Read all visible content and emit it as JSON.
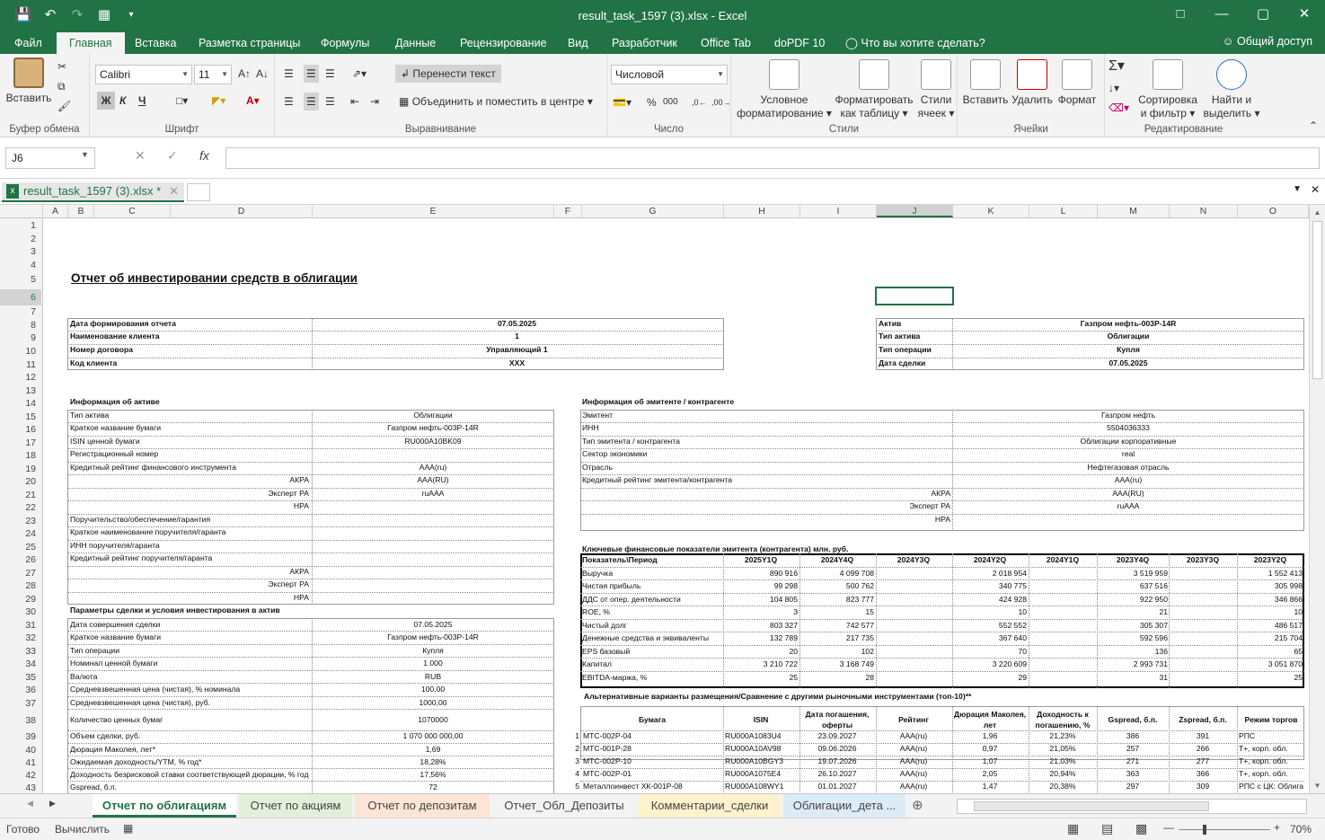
{
  "window": {
    "title": "result_task_1597 (3).xlsx - Excel",
    "share": "Общий доступ"
  },
  "tabs": [
    "Файл",
    "Главная",
    "Вставка",
    "Разметка страницы",
    "Формулы",
    "Данные",
    "Рецензирование",
    "Вид",
    "Разработчик",
    "Office Tab",
    "doPDF 10",
    "Что вы хотите сделать?"
  ],
  "ribbon": {
    "clipboard": {
      "label": "Буфер обмена",
      "paste": "Вставить"
    },
    "font": {
      "label": "Шрифт",
      "name": "Calibri",
      "size": "11",
      "bold": "Ж",
      "italic": "К",
      "underline": "Ч"
    },
    "align": {
      "label": "Выравнивание",
      "wrap": "Перенести текст",
      "merge": "Объединить и поместить в центре"
    },
    "number": {
      "label": "Число",
      "format": "Числовой",
      "pct": "%",
      "thousands": "000"
    },
    "styles": {
      "label": "Стили",
      "cond": "Условное",
      "cond2": "форматирование",
      "fmt": "Форматировать",
      "fmt2": "как таблицу",
      "cell": "Стили",
      "cell2": "ячеек"
    },
    "cells": {
      "label": "Ячейки",
      "insert": "Вставить",
      "delete": "Удалить",
      "format": "Формат"
    },
    "edit": {
      "label": "Редактирование",
      "sort": "Сортировка",
      "sort2": "и фильтр",
      "find": "Найти и",
      "find2": "выделить"
    }
  },
  "formula": {
    "namebox": "J6",
    "fx": "fx",
    "value": ""
  },
  "workbook_tab": "result_task_1597 (3).xlsx *",
  "columns": [
    "A",
    "B",
    "C",
    "D",
    "E",
    "F",
    "G",
    "H",
    "I",
    "J",
    "K",
    "L",
    "M",
    "N",
    "O"
  ],
  "rows": [
    "1",
    "2",
    "3",
    "4",
    "5",
    "6",
    "7",
    "8",
    "9",
    "10",
    "11",
    "12",
    "13",
    "14",
    "15",
    "16",
    "17",
    "18",
    "19",
    "20",
    "21",
    "22",
    "23",
    "24",
    "25",
    "26",
    "27",
    "28",
    "29",
    "30",
    "31",
    "32",
    "33",
    "34",
    "35",
    "36",
    "37",
    "38",
    "39",
    "40",
    "41",
    "42",
    "43"
  ],
  "report": {
    "title": "Отчет об инвестировании средств в облигации",
    "header": [
      [
        "Дата формирования отчета",
        "07.05.2025"
      ],
      [
        "Наименование клиента",
        "1"
      ],
      [
        "Номер договора",
        "Управляющий 1"
      ],
      [
        "Код клиента",
        "XXX"
      ]
    ],
    "asset": [
      [
        "Актив",
        "Газпром нефть-003P-14R"
      ],
      [
        "Тип актива",
        "Облигации"
      ],
      [
        "Тип операции",
        "Купля"
      ],
      [
        "Дата сделки",
        "07.05.2025"
      ]
    ],
    "info_title": "Информация об активе",
    "info": [
      [
        "Тип актива",
        "Облигации"
      ],
      [
        "Краткое название бумаги",
        "Газпром нефть-003P-14R"
      ],
      [
        "ISIN ценной бумаги",
        "RU000A10BK09"
      ],
      [
        "Регистрационный номер",
        ""
      ],
      [
        "Кредитный рейтинг финансового инструмента",
        "AAA(ru)"
      ],
      [
        "АКРА",
        "AAA(RU)"
      ],
      [
        "Эксперт РА",
        "ruAAA"
      ],
      [
        "НРА",
        ""
      ],
      [
        "Поручительство/обеспечение/гарантия",
        ""
      ],
      [
        "Краткое наименование поручителя/гаранта",
        ""
      ],
      [
        "ИНН поручителя/гаранта",
        ""
      ],
      [
        "Кредитный рейтинг поручителя/гаранта",
        ""
      ],
      [
        "АКРА",
        ""
      ],
      [
        "Эксперт РА",
        ""
      ],
      [
        "НРА",
        ""
      ]
    ],
    "params_title": "Параметры сделки и условия инвестирования в актив",
    "params": [
      [
        "Дата совершения сделки",
        "07.05.2025"
      ],
      [
        "Краткое название бумаги",
        "Газпром нефть-003P-14R"
      ],
      [
        "Тип операции",
        "Купля"
      ],
      [
        "Номинал ценной бумаги",
        "1 000"
      ],
      [
        "Валюта",
        "RUB"
      ],
      [
        "Средневзвешенная цена (чистая), % номинала",
        "100,00"
      ],
      [
        "Средневзвешенная цена (чистая), руб.",
        "1000,00"
      ],
      [
        "Количество ценных бумаг",
        "1070000"
      ],
      [
        "Объем сделки, руб.",
        "1 070 000 000,00"
      ],
      [
        "Дюрация Маколея, лет*",
        "1,69"
      ],
      [
        "Ожидаемая доходность/YTM, % год*",
        "18,28%"
      ],
      [
        "Доходность безрисковой ставки соответствующей дюрации, % год",
        "17,56%"
      ],
      [
        "Gspread, б.п.",
        "72"
      ]
    ],
    "issuer_title": "Информация об эмитенте / контрагенте",
    "issuer": [
      [
        "Эмитент",
        "Газпром нефть"
      ],
      [
        "ИНН",
        "5504036333"
      ],
      [
        "Тип эмитента / контрагента",
        "Облигации корпоративные"
      ],
      [
        "Сектор экономики",
        "real"
      ],
      [
        "Отрасль",
        "Нефтегазовая отрасль"
      ],
      [
        "Кредитный рейтинг эмитента/контрагента",
        "AAA(ru)"
      ],
      [
        "АКРА",
        "AAA(RU)"
      ],
      [
        "Эксперт РА",
        "ruAAA"
      ],
      [
        "НРА",
        ""
      ]
    ],
    "fin_title": "Ключевые финансовые показатели эмитента (контрагента) млн. руб.",
    "fin_head": [
      "Показатель\\Период",
      "2025Y1Q",
      "2024Y4Q",
      "2024Y3Q",
      "2024Y2Q",
      "2024Y1Q",
      "2023Y4Q",
      "2023Y3Q",
      "2023Y2Q"
    ],
    "fin": [
      [
        "Выручка",
        "890 916",
        "4 099 708",
        "",
        "2 018 954",
        "",
        "3 519 959",
        "",
        "1 552 413"
      ],
      [
        "Чистая прибыль",
        "99 298",
        "500 762",
        "",
        "340 775",
        "",
        "637 516",
        "",
        "305 998"
      ],
      [
        "ДДС от опер. деятельности",
        "104 805",
        "823 777",
        "",
        "424 928",
        "",
        "922 950",
        "",
        "346 866"
      ],
      [
        "ROE, %",
        "3",
        "15",
        "",
        "10",
        "",
        "21",
        "",
        "10"
      ],
      [
        "Чистый долг",
        "803 327",
        "742 577",
        "",
        "552 552",
        "",
        "305 307",
        "",
        "486 517"
      ],
      [
        "Денежные средства и эквиваленты",
        "132 789",
        "217 735",
        "",
        "367 640",
        "",
        "592 596",
        "",
        "215 704"
      ],
      [
        "EPS базовый",
        "20",
        "102",
        "",
        "70",
        "",
        "136",
        "",
        "65"
      ],
      [
        "Капитал",
        "3 210 722",
        "3 168 749",
        "",
        "3 220 609",
        "",
        "2 993 731",
        "",
        "3 051 870"
      ],
      [
        "EBITDA-маржа, %",
        "25",
        "28",
        "",
        "29",
        "",
        "31",
        "",
        "25"
      ]
    ],
    "alt_title": "Альтернативные варианты размещения/Сравнение с другими рыночными инструментами (топ-10)**",
    "alt_head": [
      "Бумага",
      "ISIN",
      "Дата погашения, оферты",
      "Рейтинг",
      "Дюрация Маколея, лет",
      "Доходность к погашению, %",
      "Gspread, б.п.",
      "Zspread, б.п.",
      "Режим торгов"
    ],
    "alt": [
      [
        "1",
        "МТС-002P-04",
        "RU000A1083U4",
        "23.09.2027",
        "AAA(ru)",
        "1,96",
        "21,23%",
        "386",
        "391",
        "РПС"
      ],
      [
        "2",
        "МТС-001P-28",
        "RU000A10AV98",
        "09.06.2026",
        "AAA(ru)",
        "0,97",
        "21,05%",
        "257",
        "266",
        "Т+, корп. обл."
      ],
      [
        "3",
        "МТС-002P-10",
        "RU000A10BGY3",
        "19.07.2026",
        "AAA(ru)",
        "1,07",
        "21,03%",
        "271",
        "277",
        "Т+, корп. обл."
      ],
      [
        "4",
        "МТС-002P-01",
        "RU000A1075E4",
        "26.10.2027",
        "AAA(ru)",
        "2,05",
        "20,94%",
        "363",
        "366",
        "Т+, корп. обл."
      ],
      [
        "5",
        "Металлоинвест ХК-001P-08",
        "RU000A108WY1",
        "01.01.2027",
        "AAA(ru)",
        "1,47",
        "20,38%",
        "297",
        "309",
        "РПС с ЦК: Облигаци"
      ]
    ]
  },
  "sheets": [
    "Отчет по облигациям",
    "Отчет по акциям",
    "Отчет по депозитам",
    "Отчет_Обл_Депозиты",
    "Комментарии_сделки",
    "Облигации_дета"
  ],
  "status": {
    "ready": "Готово",
    "calc": "Вычислить",
    "zoom": "70%"
  }
}
